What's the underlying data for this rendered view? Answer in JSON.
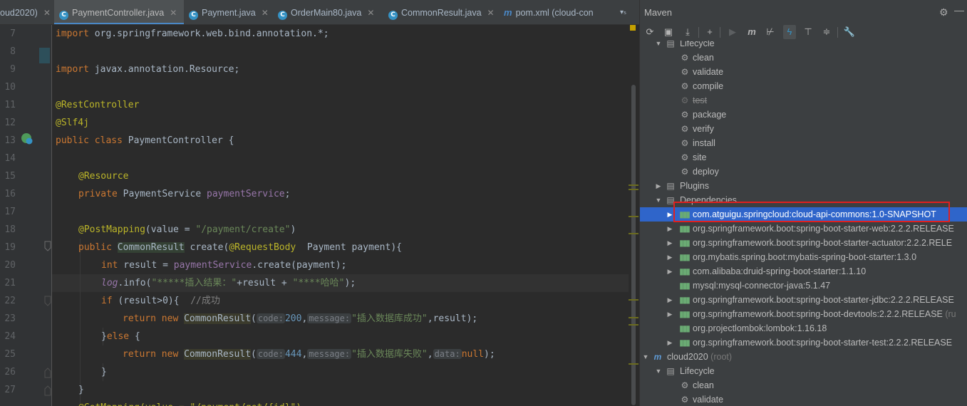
{
  "tabs": [
    {
      "label": "oud2020)",
      "icon": "",
      "active": false
    },
    {
      "label": "PaymentController.java",
      "icon": "C",
      "active": true
    },
    {
      "label": "Payment.java",
      "icon": "C",
      "active": false
    },
    {
      "label": "OrderMain80.java",
      "icon": "C",
      "active": false
    },
    {
      "label": "CommonResult.java",
      "icon": "C",
      "active": false
    },
    {
      "label": "pom.xml (cloud-con",
      "icon": "m",
      "active": false
    }
  ],
  "tab_overflow": "▾₅",
  "line_numbers": [
    "7",
    "8",
    "9",
    "10",
    "11",
    "12",
    "13",
    "14",
    "15",
    "16",
    "17",
    "18",
    "19",
    "20",
    "21",
    "22",
    "23",
    "24",
    "25",
    "26",
    "27"
  ],
  "code": {
    "l7": {
      "kw": "import",
      "rest": " org.springframework.web.bind.annotation.*;"
    },
    "l9": {
      "kw": "import",
      "rest": " javax.annotation.Resource;"
    },
    "l11": "@RestController",
    "l12": "@Slf4j",
    "l13": {
      "kw": "public class",
      "rest": " PaymentController {"
    },
    "l15": "@Resource",
    "l16": {
      "kw": "private",
      "type": " PaymentService ",
      "field": "paymentService",
      "end": ";"
    },
    "l18": {
      "ann": "@PostMapping",
      "a": "(value = ",
      "str": "\"/payment/create\"",
      "b": ")"
    },
    "l19": {
      "kw": "public",
      "cls": "CommonResult",
      "m": " create(",
      "ann": "@RequestBody",
      "rest": "  Payment payment){"
    },
    "l20": {
      "kw": "int",
      "a": " result = ",
      "field": "paymentService",
      "b": ".create(payment);"
    },
    "l21": {
      "stat": "log",
      "a": ".info(",
      "str1": "\"*****插入结果：\"",
      "b": "+result + ",
      "str2": "\"****哈哈\"",
      "c": ");"
    },
    "l22": {
      "kw": "if",
      "a": " (result>0){  ",
      "cmt": "//成功"
    },
    "l23": {
      "kw": "return new",
      "cls": "CommonResult",
      "h1": "code:",
      "n1": "200",
      "h2": "message:",
      "str": "\"插入数据库成功\"",
      "end": ",result);"
    },
    "l24": {
      "a": "}",
      "kw": "else",
      "b": " {"
    },
    "l25": {
      "kw": "return new",
      "cls": "CommonResult",
      "h1": "code:",
      "n1": "444",
      "h2": "message:",
      "str": "\"插入数据库失败\"",
      "h3": "data:",
      "kw2": "null",
      "end": ");"
    },
    "l26": "}",
    "l27": "}",
    "l28_partial": "@GetMapping(value = \"/payment/get/{id}\")"
  },
  "maven": {
    "title": "Maven",
    "toolbar": [
      "refresh-icon",
      "generate-sources-icon",
      "download-icon",
      "plus-icon",
      "run-icon",
      "execute-goal-icon",
      "toggle-offline-icon",
      "skip-tests-icon",
      "show-dependencies-icon",
      "collapse-icon",
      "settings-wrench-icon"
    ],
    "tree": [
      {
        "label": "Lifecycle",
        "level": 1,
        "kind": "folder",
        "arrow": "open"
      },
      {
        "label": "clean",
        "level": 2,
        "kind": "goal"
      },
      {
        "label": "validate",
        "level": 2,
        "kind": "goal"
      },
      {
        "label": "compile",
        "level": 2,
        "kind": "goal"
      },
      {
        "label": "test",
        "level": 2,
        "kind": "goal",
        "struck": true
      },
      {
        "label": "package",
        "level": 2,
        "kind": "goal"
      },
      {
        "label": "verify",
        "level": 2,
        "kind": "goal"
      },
      {
        "label": "install",
        "level": 2,
        "kind": "goal"
      },
      {
        "label": "site",
        "level": 2,
        "kind": "goal"
      },
      {
        "label": "deploy",
        "level": 2,
        "kind": "goal"
      },
      {
        "label": "Plugins",
        "level": 1,
        "kind": "folder",
        "arrow": "closed"
      },
      {
        "label": "Dependencies",
        "level": 1,
        "kind": "folder",
        "arrow": "open"
      },
      {
        "label": "com.atguigu.springcloud:cloud-api-commons:1.0-SNAPSHOT",
        "level": 2,
        "kind": "dep",
        "arrow": "closed",
        "selected": true
      },
      {
        "label": "org.springframework.boot:spring-boot-starter-web:2.2.2.RELEASE",
        "level": 2,
        "kind": "dep",
        "arrow": "closed"
      },
      {
        "label": "org.springframework.boot:spring-boot-starter-actuator:2.2.2.RELE",
        "level": 2,
        "kind": "dep",
        "arrow": "closed"
      },
      {
        "label": "org.mybatis.spring.boot:mybatis-spring-boot-starter:1.3.0",
        "level": 2,
        "kind": "dep",
        "arrow": "closed"
      },
      {
        "label": "com.alibaba:druid-spring-boot-starter:1.1.10",
        "level": 2,
        "kind": "dep",
        "arrow": "closed"
      },
      {
        "label": "mysql:mysql-connector-java:5.1.47",
        "level": 2,
        "kind": "dep"
      },
      {
        "label": "org.springframework.boot:spring-boot-starter-jdbc:2.2.2.RELEASE",
        "level": 2,
        "kind": "dep",
        "arrow": "closed"
      },
      {
        "label": "org.springframework.boot:spring-boot-devtools:2.2.2.RELEASE",
        "suffix": " (ru",
        "level": 2,
        "kind": "dep",
        "arrow": "closed"
      },
      {
        "label": "org.projectlombok:lombok:1.16.18",
        "level": 2,
        "kind": "dep"
      },
      {
        "label": "org.springframework.boot:spring-boot-starter-test:2.2.2.RELEASE",
        "level": 2,
        "kind": "dep",
        "arrow": "closed"
      },
      {
        "label": "cloud2020",
        "suffix": " (root)",
        "level": 0,
        "kind": "module",
        "arrow": "open"
      },
      {
        "label": "Lifecycle",
        "level": 1,
        "kind": "folder",
        "arrow": "open"
      },
      {
        "label": "clean",
        "level": 2,
        "kind": "goal"
      },
      {
        "label": "validate",
        "level": 2,
        "kind": "goal"
      }
    ]
  },
  "colors": {
    "accent": "#4a88c7",
    "selection": "#2f65ca",
    "highlight_box": "#e02020"
  }
}
